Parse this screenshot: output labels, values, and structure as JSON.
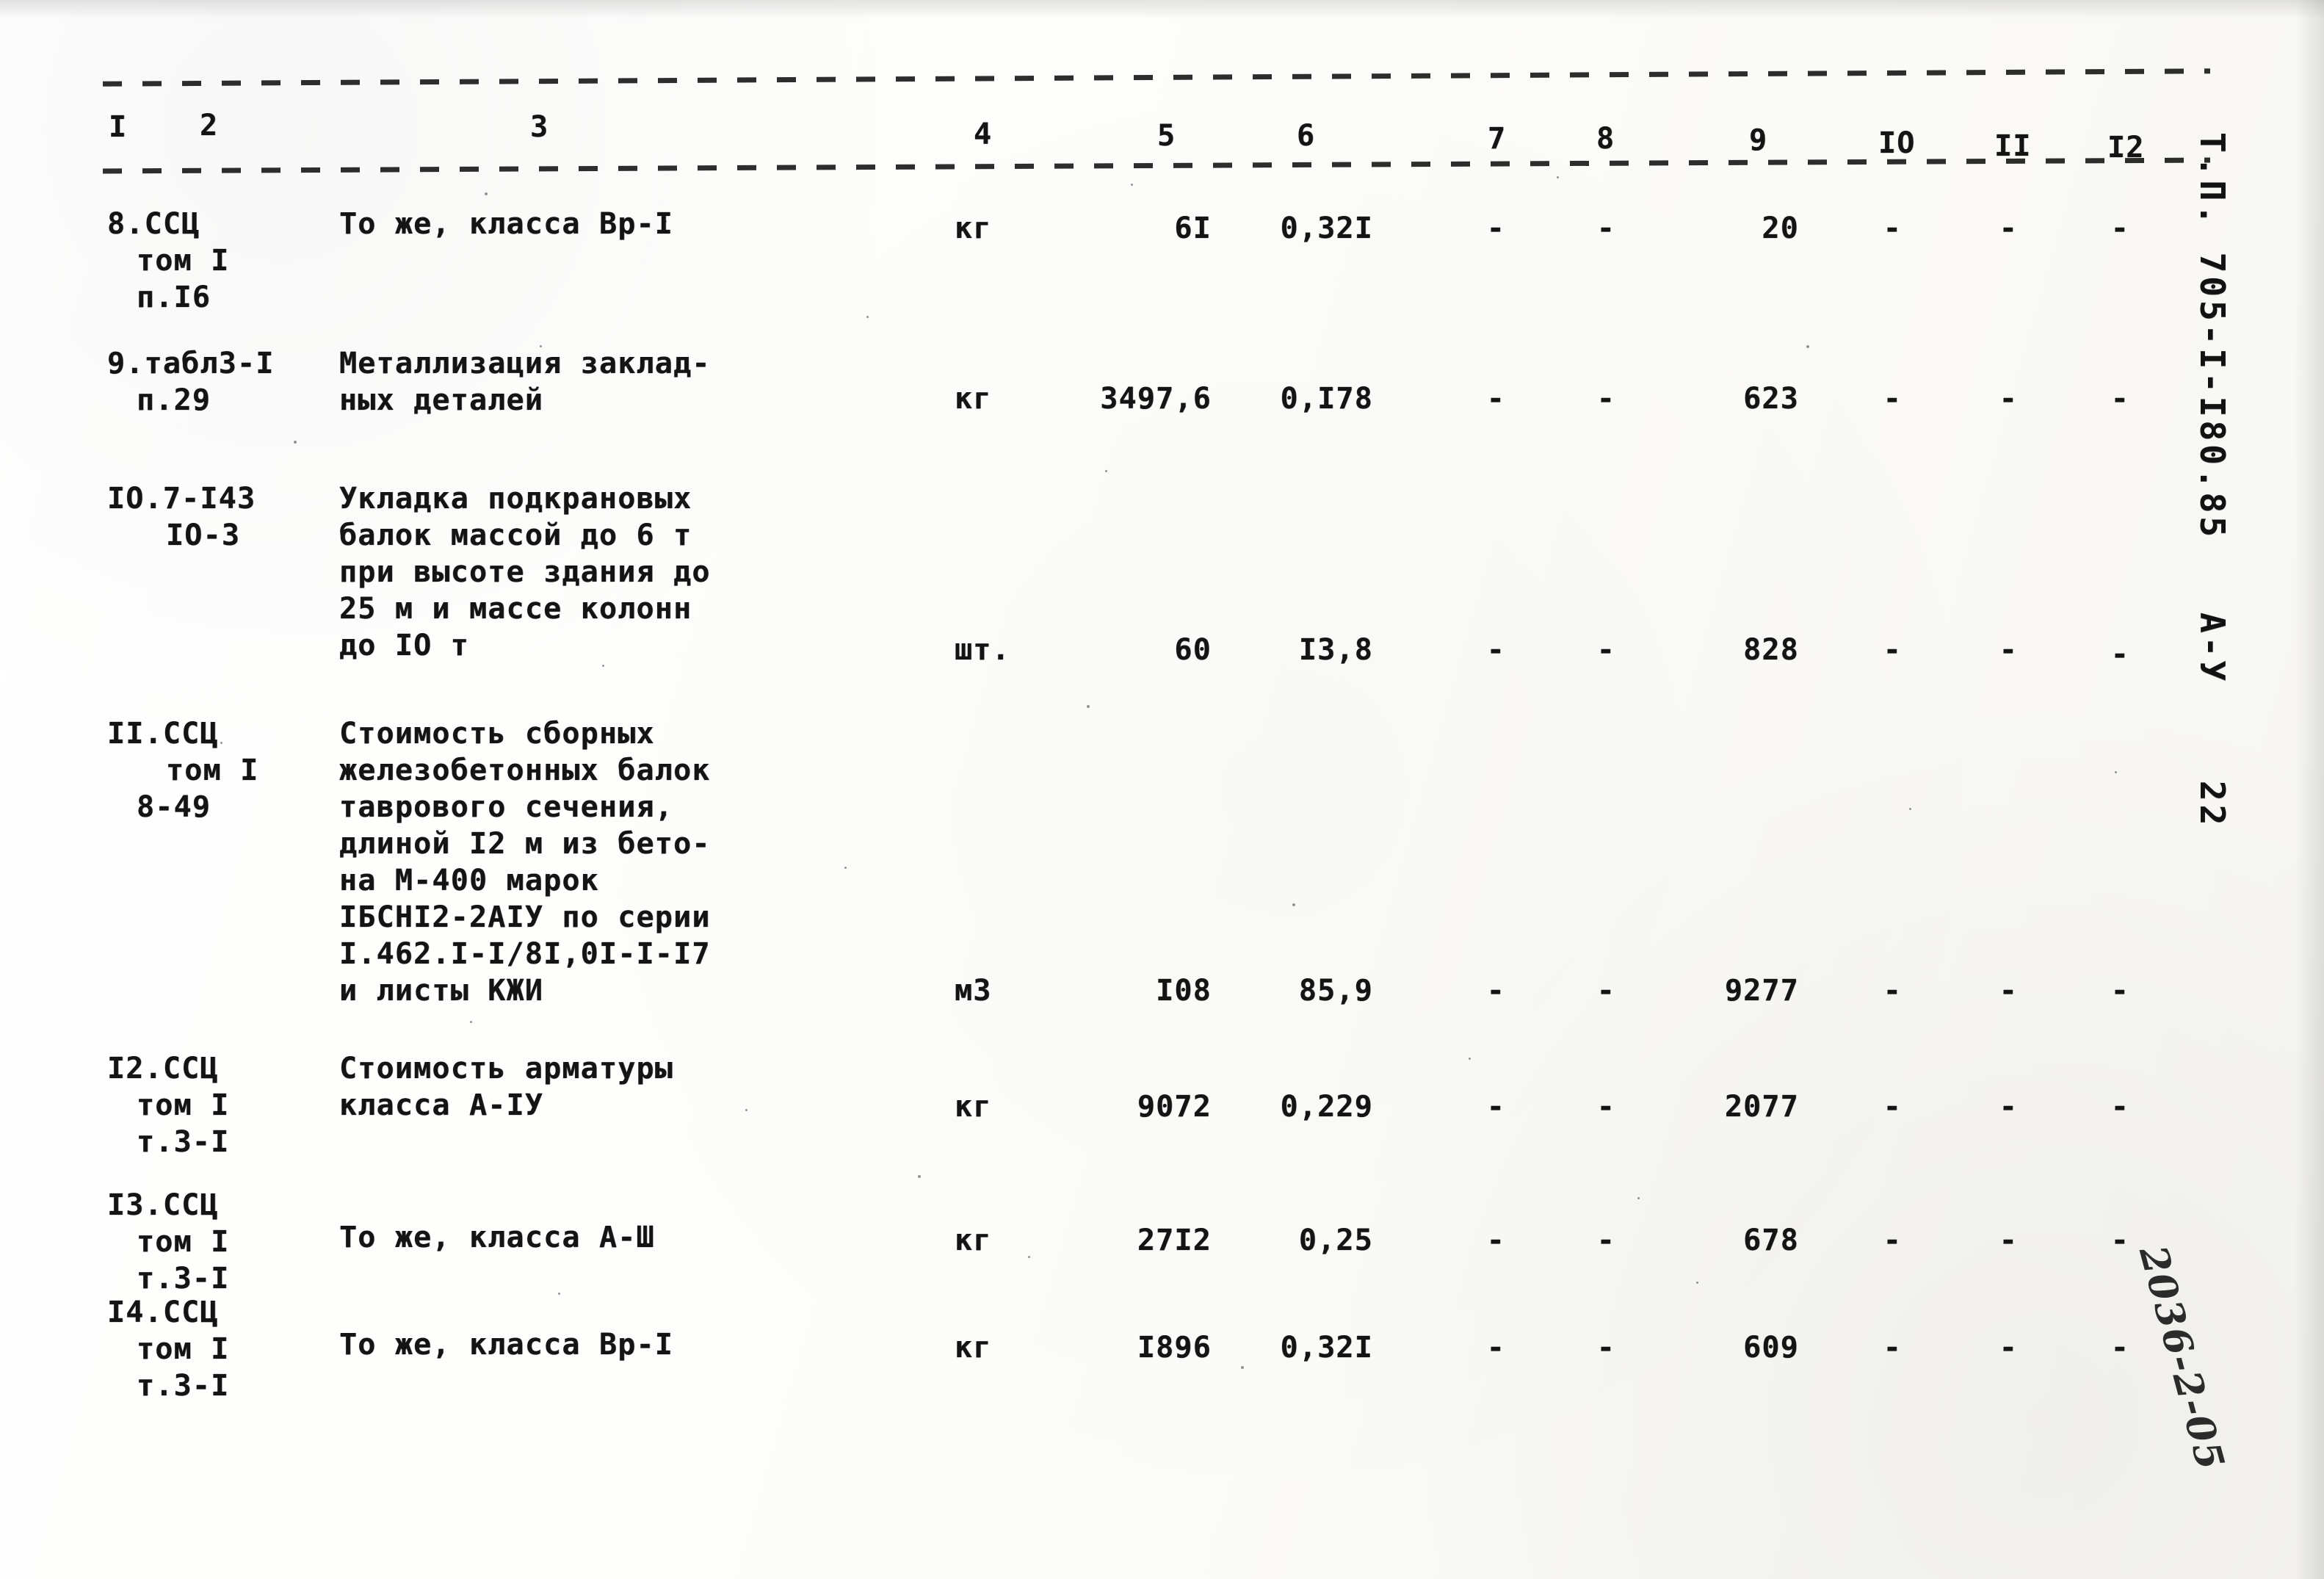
{
  "document": {
    "margin_stamp": "Т.П. 705-I-I80.85   А-У    22",
    "archive_number": "2036-2-05"
  },
  "table": {
    "column_headers": [
      "I",
      "2",
      "3",
      "4",
      "5",
      "6",
      "7",
      "8",
      "9",
      "IO",
      "II",
      "I2"
    ],
    "rows": [
      {
        "code": [
          "8.ССЦ",
          "том I",
          "п.I6"
        ],
        "description": [
          "То же, класса Вр-I"
        ],
        "unit": "кг",
        "c5": "6I",
        "c6": "0,32I",
        "c7": "-",
        "c8": "-",
        "c9": "20",
        "c10": "-",
        "c11": "-",
        "c12": "-"
      },
      {
        "code": [
          "9.табл3-I",
          "п.29"
        ],
        "description": [
          "Металлизация заклад-",
          "ных деталей"
        ],
        "unit": "кг",
        "c5": "3497,6",
        "c6": "0,I78",
        "c7": "-",
        "c8": "-",
        "c9": "623",
        "c10": "-",
        "c11": "-",
        "c12": "-"
      },
      {
        "code": [
          "IO.7-I43",
          "IO-3"
        ],
        "description": [
          "Укладка подкрановых",
          "балок массой до 6 т",
          "при высоте здания до",
          "25 м и массе колонн",
          "до IO т"
        ],
        "unit": "шт.",
        "c5": "60",
        "c6": "I3,8",
        "c7": "-",
        "c8": "-",
        "c9": "828",
        "c10": "-",
        "c11": "-",
        "c12": "-"
      },
      {
        "code": [
          "II.ССЦ",
          "том I",
          "8-49"
        ],
        "description": [
          "Стоимость сборных",
          "железобетонных балок",
          "таврового сечения,",
          "длиной I2 м из бето-",
          "на М-400 марок",
          "IБСНI2-2АIУ по серии",
          "I.462.I-I/8I,0I-I-I7",
          "и листы КЖИ"
        ],
        "unit": "м3",
        "c5": "I08",
        "c6": "85,9",
        "c7": "-",
        "c8": "-",
        "c9": "9277",
        "c10": "-",
        "c11": "-",
        "c12": "-"
      },
      {
        "code": [
          "I2.ССЦ",
          "том I",
          "т.3-I"
        ],
        "description": [
          "Стоимость арматуры",
          "класса А-IУ"
        ],
        "unit": "кг",
        "c5": "9072",
        "c6": "0,229",
        "c7": "-",
        "c8": "-",
        "c9": "2077",
        "c10": "-",
        "c11": "-",
        "c12": "-"
      },
      {
        "code": [
          "I3.ССЦ",
          "том I",
          "т.3-I"
        ],
        "description": [
          "То же, класса А-Ш"
        ],
        "unit": "кг",
        "c5": "27I2",
        "c6": "0,25",
        "c7": "-",
        "c8": "-",
        "c9": "678",
        "c10": "-",
        "c11": "-",
        "c12": "-"
      },
      {
        "code": [
          "I4.ССЦ",
          "том I",
          "т.3-I"
        ],
        "description": [
          "То же, класса Вр-I"
        ],
        "unit": "кг",
        "c5": "I896",
        "c6": "0,32I",
        "c7": "-",
        "c8": "-",
        "c9": "609",
        "c10": "-",
        "c11": "-",
        "c12": "-"
      }
    ]
  }
}
